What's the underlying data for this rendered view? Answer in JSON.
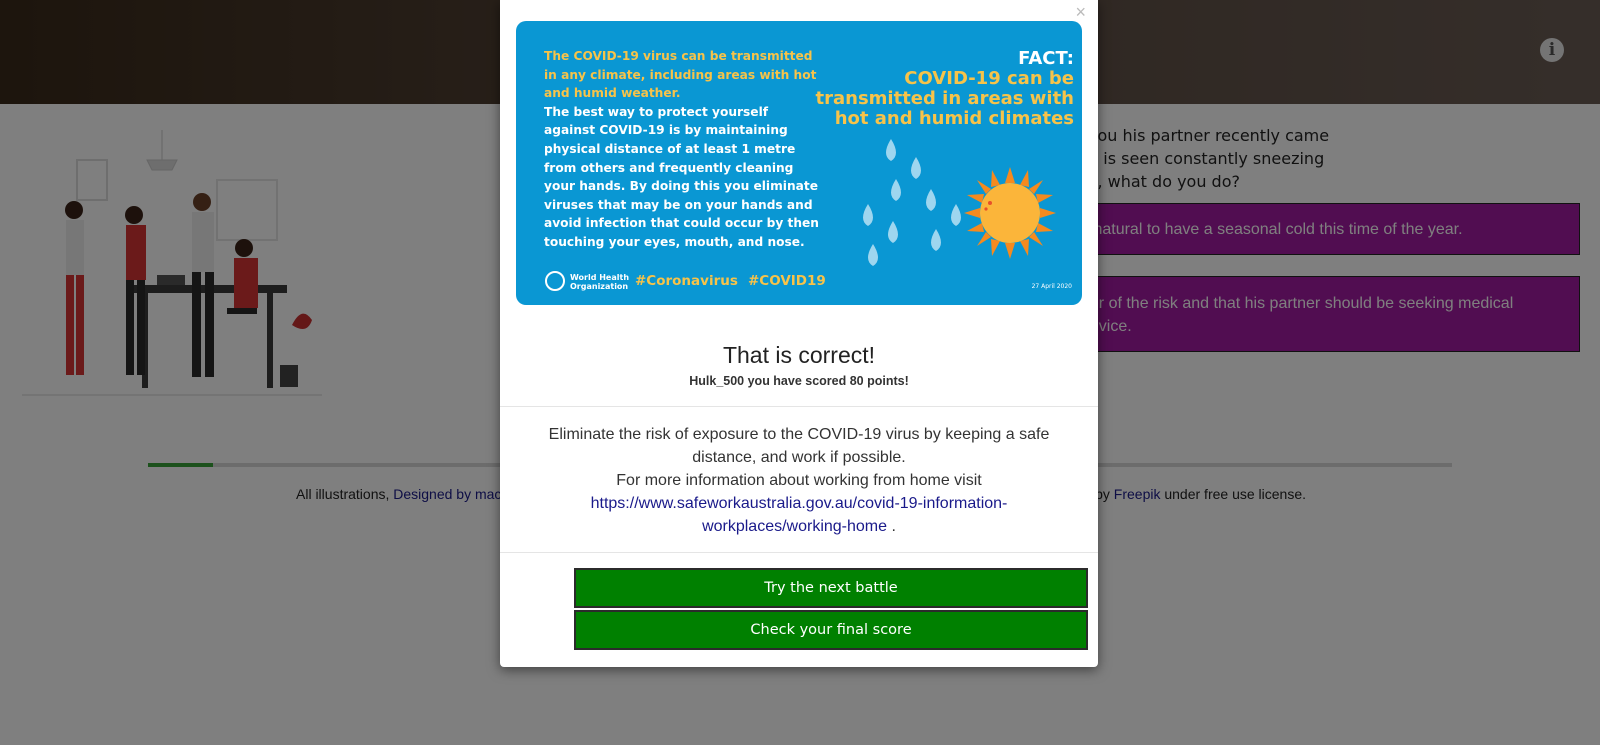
{
  "header": {
    "info_icon": "info-icon"
  },
  "question": {
    "lines": [
      "you his partner recently came",
      "d is seen constantly sneezing",
      "y, what do you do?"
    ]
  },
  "options": [
    {
      "text": "y natural to have a seasonal cold this time of the year."
    },
    {
      "line1": "ger of the risk and that his partner should be seeking medical",
      "line2": "advice."
    }
  ],
  "progress": {
    "fraction": 0.05,
    "color": "#39a339"
  },
  "credits": {
    "prefix": "All illustrations,",
    "link1": "Designed by mac",
    "by": "by",
    "link2": "Freepik",
    "suffix": "under free use license."
  },
  "modal": {
    "close_label": "×",
    "card": {
      "lead": "The COVID-19 virus can be transmitted in any climate, including areas with hot and humid weather.",
      "body": "The best way to protect yourself against COVID-19 is by maintaining physical distance of at least 1 metre from others and frequently cleaning your hands. By doing this you eliminate viruses that may be on your hands and avoid infection that could occur by then touching your eyes, mouth, and nose.",
      "fact_label": "FACT:",
      "headline": "COVID-19 can be transmitted in areas with hot and humid climates",
      "org": "World Health Organization",
      "tag1": "#Coronavirus",
      "tag2": "#COVID19",
      "date": "27 April 2020"
    },
    "result_title": "That is correct!",
    "result_score": "Hulk_500 you have scored 80 points!",
    "message_line1": "Eliminate the risk of exposure to the COVID-19 virus by keeping a safe distance, and work if possible.",
    "message_line2": "For more information about working from home visit",
    "message_link": "https://www.safeworkaustralia.gov.au/covid-19-information-workplaces/working-home",
    "message_end": ".",
    "next_button": "Try the next battle",
    "score_button": "Check your final score"
  },
  "colors": {
    "button_green": "#008000",
    "option_purple": "#a31aa3",
    "card_blue": "#0a97d3",
    "card_yellow": "#f7c349"
  }
}
